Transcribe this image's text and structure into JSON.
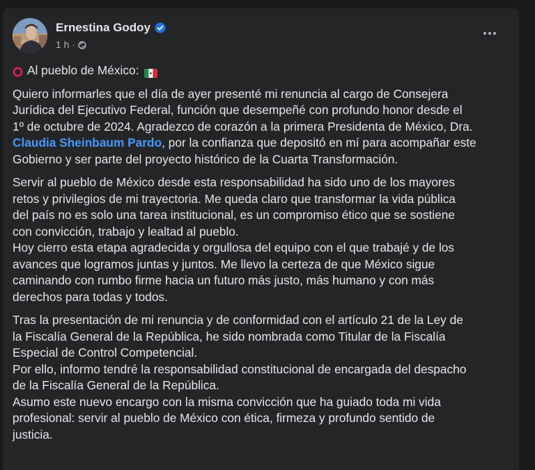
{
  "post": {
    "author": "Ernestina Godoy",
    "time": "1 h",
    "meta_separator": "·",
    "headline": "Al pueblo de México:",
    "paragraph1": {
      "line1": "Quiero informarles que el día de ayer presenté mi renuncia al cargo de Consejera",
      "line2": "Jurídica del Ejecutivo Federal, función que desempeñé con profundo honor desde el",
      "line3": "1º de octubre de 2024. Agradezco de corazón a la primera Presidenta de México, Dra.",
      "mention": "Claudia Sheinbaum Pardo",
      "line4_rest": ", por la confianza que depositó en mí para acompañar este",
      "line5": "Gobierno y ser parte del proyecto histórico de la Cuarta Transformación."
    },
    "paragraph2": {
      "line1": "Servir al pueblo de México desde esta responsabilidad ha sido uno de los mayores",
      "line2": "retos y privilegios de mi trayectoria. Me queda claro que transformar la vida pública",
      "line3": "del país no es solo una tarea institucional, es un compromiso ético que se sostiene",
      "line4": "con convicción, trabajo y lealtad al pueblo.",
      "line5": "Hoy cierro esta etapa agradecida y orgullosa del equipo con el que trabajé y de los",
      "line6": "avances que logramos juntas y juntos. Me llevo la certeza de que México sigue",
      "line7": "caminando con rumbo firme hacia un futuro más justo, más humano y con más",
      "line8": "derechos para todas y todos."
    },
    "paragraph3": {
      "line1": "Tras la presentación de mi renuncia y de conformidad con el artículo 21 de la Ley de",
      "line2": "la Fiscalía General de la República, he sido nombrada como Titular de la Fiscalía",
      "line3": "Especial de Control Competencial.",
      "line4": "Por ello, informo tendré la responsabilidad constitucional de encargada del despacho",
      "line5": "de la Fiscalía General de la República.",
      "line6": "Asumo este nuevo encargo con la misma convicción que ha guiado toda mi vida",
      "line7": "profesional: servir al pueblo de México con ética, firmeza y profundo sentido de",
      "line8": "justicia."
    }
  },
  "colors": {
    "background": "#18191a",
    "card": "#242526",
    "text": "#e4e6eb",
    "secondary_text": "#b0b3b8",
    "link": "#4599ff",
    "verified": "#1b74e4",
    "red_circle": "#e0245e"
  },
  "icons": {
    "verified": "verified-badge-icon",
    "audience": "globe-icon",
    "more": "more-options-icon",
    "headline_marker": "red-circle-icon",
    "flag": "mexico-flag-icon"
  }
}
